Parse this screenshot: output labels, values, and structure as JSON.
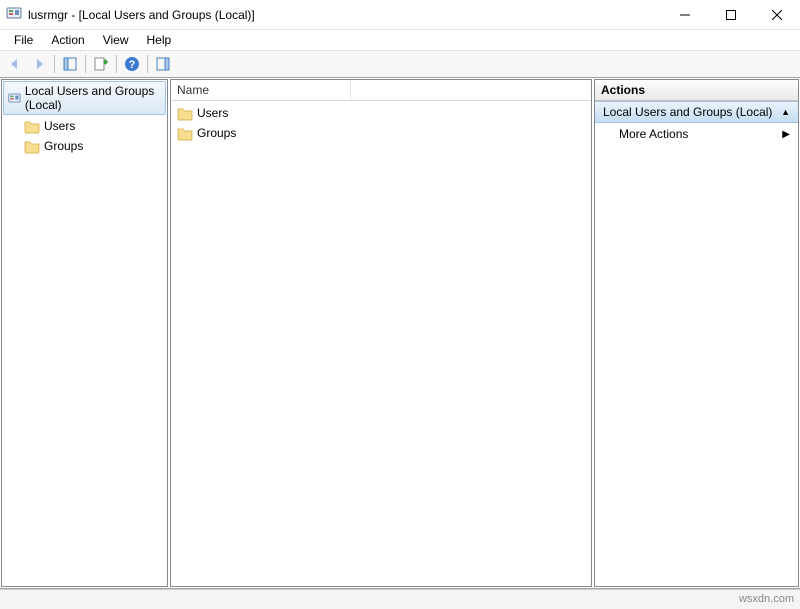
{
  "window": {
    "title": "lusrmgr - [Local Users and Groups (Local)]"
  },
  "menu": {
    "file": "File",
    "action": "Action",
    "view": "View",
    "help": "Help"
  },
  "tree": {
    "root": "Local Users and Groups (Local)",
    "children": [
      {
        "label": "Users"
      },
      {
        "label": "Groups"
      }
    ]
  },
  "list": {
    "column": "Name",
    "rows": [
      {
        "label": "Users"
      },
      {
        "label": "Groups"
      }
    ]
  },
  "actions": {
    "header": "Actions",
    "selection": "Local Users and Groups (Local)",
    "more": "More Actions"
  },
  "watermark": "wsxdn.com"
}
